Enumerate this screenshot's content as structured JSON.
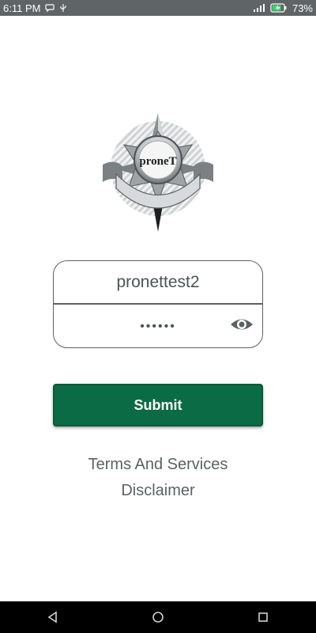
{
  "status_bar": {
    "time": "6:11 PM",
    "battery": "73%",
    "icons": [
      "message-icon",
      "usb-icon",
      "signal-icon",
      "battery-charging-icon"
    ]
  },
  "logo": {
    "text": "proneT",
    "icon": "compass-emblem-logo"
  },
  "login": {
    "username": "pronettest2",
    "password_mask": "••••••",
    "eye_icon": "eye-icon"
  },
  "submit": {
    "label": "Submit",
    "color": "#0b6b45"
  },
  "links": {
    "terms": "Terms And Services",
    "disclaimer": "Disclaimer"
  },
  "navbar": {
    "icons": [
      "back-icon",
      "home-icon",
      "recents-icon"
    ]
  },
  "colors": {
    "statusbar": "#5f6466",
    "text": "#5b6163",
    "accent": "#0b6b45"
  }
}
